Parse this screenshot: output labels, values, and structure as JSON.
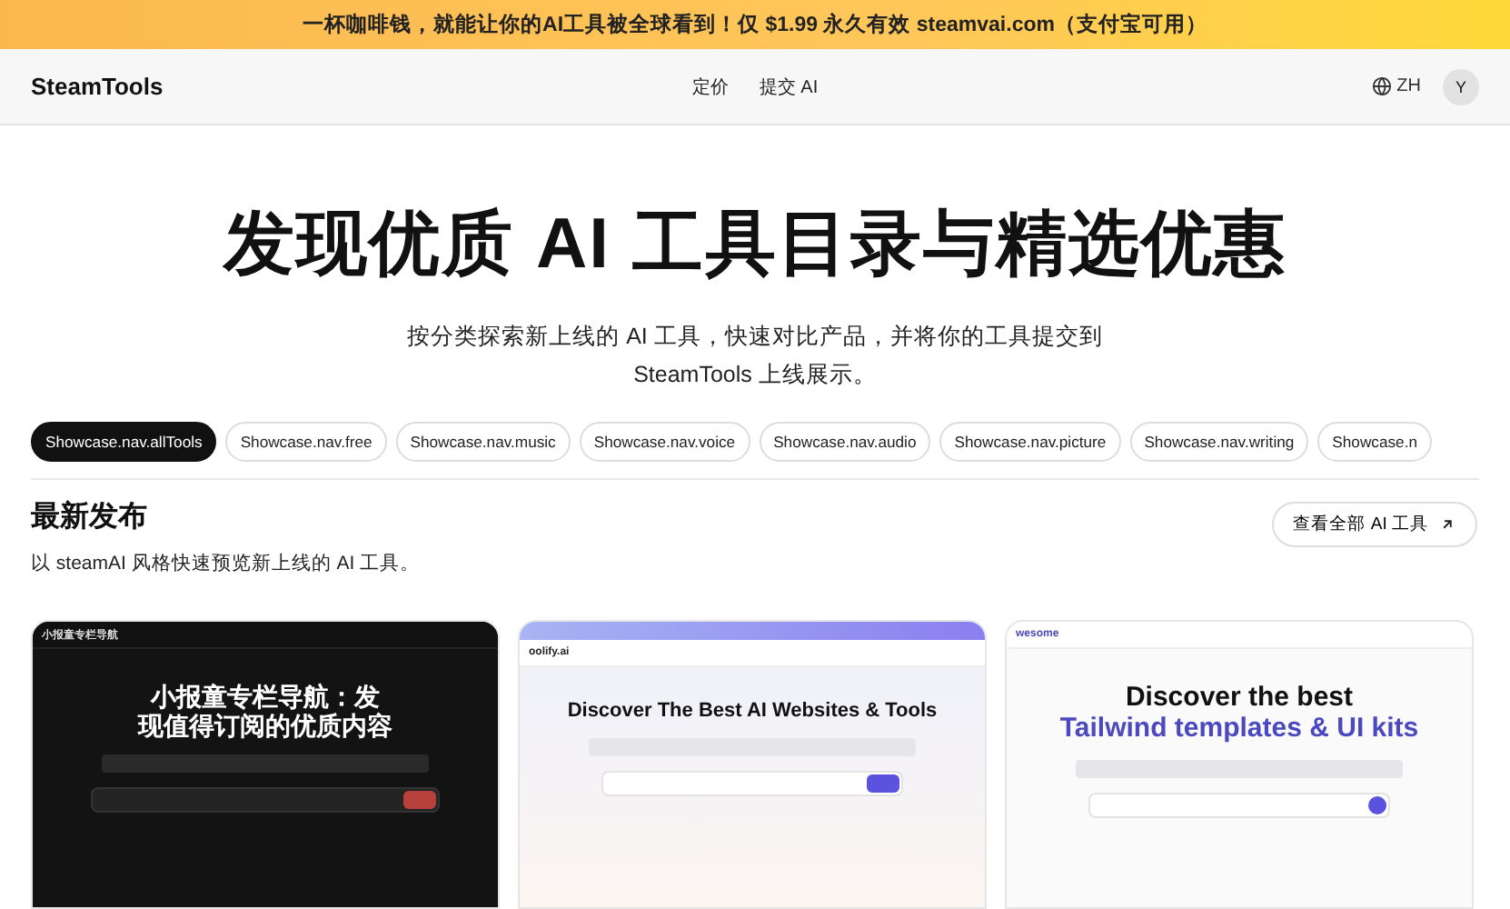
{
  "banner": {
    "text": "一杯咖啡钱，就能让你的AI工具被全球看到！仅 $1.99 永久有效 steamvai.com（支付宝可用）"
  },
  "nav": {
    "logo": "SteamTools",
    "links": [
      "定价",
      "提交 AI"
    ],
    "language": "ZH",
    "avatar": "Y"
  },
  "hero": {
    "title": "发现优质 AI 工具目录与精选优惠",
    "subtitle_lines": [
      "按分类探索新上线的 AI 工具，快速对比产品，并将你的工具提交到",
      "SteamTools 上线展示。"
    ]
  },
  "tabs": [
    {
      "label": "Showcase.nav.allTools",
      "selected": true
    },
    {
      "label": "Showcase.nav.free",
      "selected": false
    },
    {
      "label": "Showcase.nav.music",
      "selected": false
    },
    {
      "label": "Showcase.nav.voice",
      "selected": false
    },
    {
      "label": "Showcase.nav.audio",
      "selected": false
    },
    {
      "label": "Showcase.nav.picture",
      "selected": false
    },
    {
      "label": "Showcase.nav.writing",
      "selected": false
    },
    {
      "label": "Showcase.n",
      "selected": false
    }
  ],
  "section": {
    "title": "最新发布",
    "description": "以 steamAI 风格快速预览新上线的 AI 工具。",
    "button": "查看全部 AI 工具"
  },
  "cards": [
    {
      "kind": "dark",
      "site": "小报童专栏导航",
      "headline_lines": [
        "小报童专栏导航：发",
        "现值得订阅的优质内容"
      ]
    },
    {
      "kind": "gradient",
      "site": "oolify.ai",
      "headline_lines": [
        "Discover The Best AI Websites & Tools"
      ]
    },
    {
      "kind": "light",
      "site": "wesome",
      "headline_lines": [
        "Discover the best",
        "Tailwind templates & UI kits"
      ]
    }
  ]
}
